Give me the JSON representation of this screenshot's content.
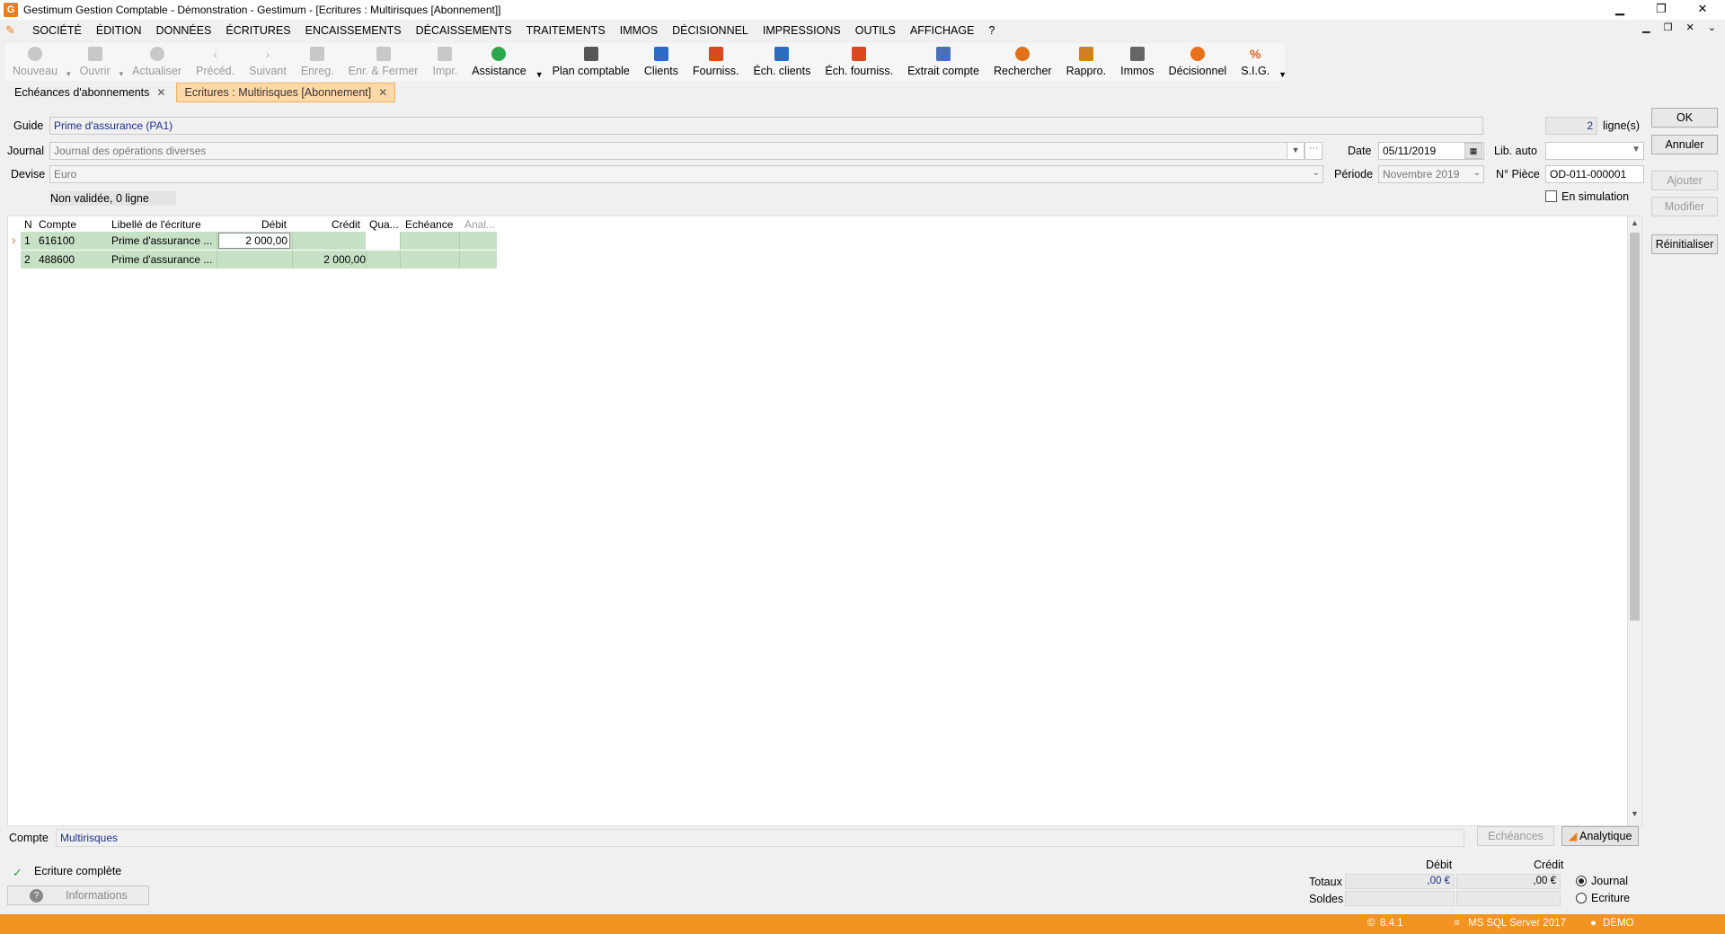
{
  "window": {
    "title": "Gestimum Gestion Comptable - Démonstration - Gestimum - [Ecritures : Multirisques [Abonnement]]",
    "minimize": "▁",
    "restore": "❐",
    "close": "✕"
  },
  "menu": [
    "SOCIÉTÉ",
    "ÉDITION",
    "DONNÉES",
    "ÉCRITURES",
    "ENCAISSEMENTS",
    "DÉCAISSEMENTS",
    "TRAITEMENTS",
    "IMMOS",
    "DÉCISIONNEL",
    "IMPRESSIONS",
    "OUTILS",
    "AFFICHAGE",
    "?"
  ],
  "mdi_controls": "▁ ❐ ✕ ⌄",
  "toolbar": {
    "nouveau": "Nouveau",
    "ouvrir": "Ouvrir",
    "actualiser": "Actualiser",
    "preced": "Précéd.",
    "suivant": "Suivant",
    "enreg": "Enreg.",
    "enr_fermer": "Enr. & Fermer",
    "impr": "Impr.",
    "assistance": "Assistance",
    "plan_comptable": "Plan comptable",
    "clients": "Clients",
    "fourniss": "Fourniss.",
    "ech_clients": "Éch. clients",
    "ech_fourniss": "Éch. fourniss.",
    "extrait_compte": "Extrait compte",
    "rechercher": "Rechercher",
    "rappro": "Rappro.",
    "immos": "Immos",
    "decisionnel": "Décisionnel",
    "sig": "S.I.G.",
    "colors": {
      "assistance": "#2aa84a",
      "plan": "#555555",
      "clients": "#2b6cc4",
      "fourniss": "#d9481f",
      "ech_clients": "#2b6cc4",
      "ech_fourniss": "#d9481f",
      "extrait": "#4b70b8",
      "rechercher": "#e0701a",
      "rappro": "#d08020",
      "immos": "#666666",
      "decisionnel": "#e8701a",
      "sig": "#e06020"
    }
  },
  "tabs": [
    {
      "label": "Echéances d'abonnements"
    },
    {
      "label": "Ecritures : Multirisques [Abonnement]"
    }
  ],
  "form": {
    "guide_label": "Guide",
    "guide_value": "Prime d'assurance (PA1)",
    "journal_label": "Journal",
    "journal_value": "Journal des opérations diverses",
    "devise_label": "Devise",
    "devise_value": "Euro",
    "status_text": "Non validée, 0 ligne",
    "lignes_count": "2",
    "lignes_label": "ligne(s)",
    "date_label": "Date",
    "date_value": "05/11/2019",
    "periode_label": "Période",
    "periode_value": "Novembre 2019",
    "libauto_label": "Lib. auto",
    "libauto_value": "",
    "piece_label": "N° Pièce",
    "piece_value": "OD-011-000001",
    "simulation_label": "En simulation"
  },
  "buttons": {
    "ok": "OK",
    "annuler": "Annuler",
    "ajouter": "Ajouter",
    "modifier": "Modifier",
    "reinitialiser": "Réinitialiser"
  },
  "grid": {
    "headers": [
      "N",
      "Compte",
      "Libellé de l'écriture",
      "Débit",
      "Crédit",
      "Qua...",
      "Echéance",
      "Anal..."
    ],
    "rows": [
      {
        "n": "1",
        "compte": "616100",
        "libelle": "Prime d'assurance ...",
        "debit": "2 000,00",
        "credit": "",
        "qua": "",
        "echeance": "",
        "anal": ""
      },
      {
        "n": "2",
        "compte": "488600",
        "libelle": "Prime d'assurance ...",
        "debit": "",
        "credit": "2 000,00",
        "qua": "",
        "echeance": "",
        "anal": ""
      }
    ],
    "current_row_marker": "›"
  },
  "bottom": {
    "compte_label": "Compte",
    "compte_value": "Multirisques",
    "echeances_btn": "Echéances",
    "analytique_btn": "Analytique",
    "ecriture_complete": "Ecriture complète",
    "informations": "Informations",
    "debit_header": "Débit",
    "credit_header": "Crédit",
    "totaux_label": "Totaux",
    "soldes_label": "Soldes",
    "totaux_debit": ",00 €",
    "totaux_credit": ",00 €",
    "soldes_debit": "",
    "soldes_credit": "",
    "radio_journal": "Journal",
    "radio_ecriture": "Ecriture"
  },
  "statusbar": {
    "version": "8.4.1",
    "db": "MS SQL Server 2017",
    "user": "DEMO"
  }
}
